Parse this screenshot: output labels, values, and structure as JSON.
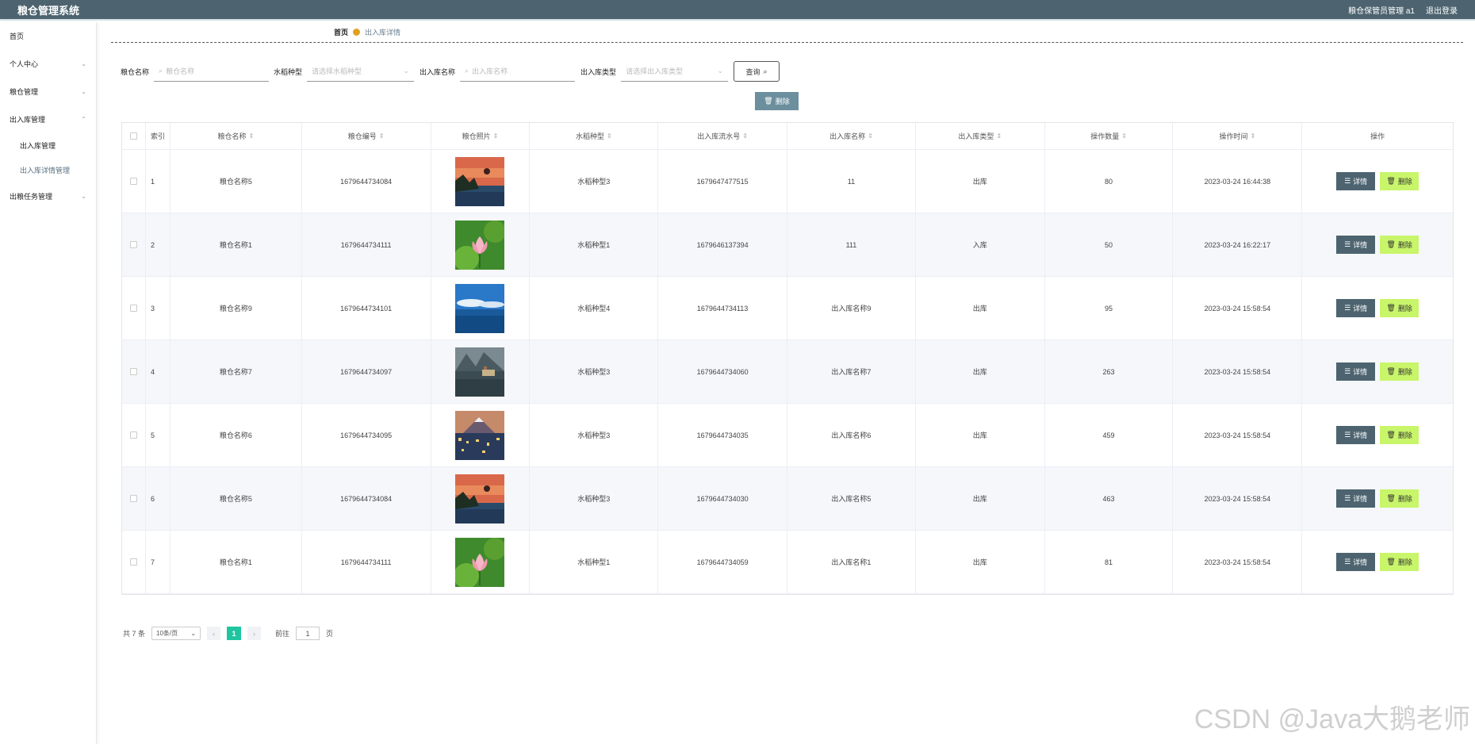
{
  "header": {
    "title": "粮仓管理系统",
    "user": "粮仓保管员管理 a1",
    "logout": "退出登录"
  },
  "sidebar": {
    "items": [
      {
        "label": "首页"
      },
      {
        "label": "个人中心"
      },
      {
        "label": "粮仓管理"
      },
      {
        "label": "出入库管理"
      }
    ],
    "sub_items": [
      {
        "label": "出入库管理"
      },
      {
        "label": "出入库详情管理"
      }
    ],
    "last_item": {
      "label": "出粮任务管理"
    }
  },
  "breadcrumb": {
    "home": "首页",
    "current": "出入库详情"
  },
  "search": {
    "name_label": "粮仓名称",
    "name_placeholder": "粮仓名称",
    "type_label": "水稻种型",
    "type_placeholder": "请选择水稻种型",
    "ioname_label": "出入库名称",
    "ioname_placeholder": "出入库名称",
    "iotype_label": "出入库类型",
    "iotype_placeholder": "请选择出入库类型",
    "query_label": "查询"
  },
  "toolbar": {
    "delete_label": "删除"
  },
  "table": {
    "columns": [
      "索引",
      "粮仓名称",
      "粮仓编号",
      "粮仓照片",
      "水稻种型",
      "出入库流水号",
      "出入库名称",
      "出入库类型",
      "操作数量",
      "操作时间",
      "操作"
    ],
    "rows": [
      {
        "idx": "1",
        "name": "粮仓名称5",
        "num": "1679644734084",
        "img": "sunset-lake",
        "type": "水稻种型3",
        "flow": "1679647477515",
        "ioname": "11",
        "iotype": "出库",
        "qty": "80",
        "time": "2023-03-24 16:44:38"
      },
      {
        "idx": "2",
        "name": "粮仓名称1",
        "num": "1679644734111",
        "img": "lotus",
        "type": "水稻种型1",
        "flow": "1679646137394",
        "ioname": "111",
        "iotype": "入库",
        "qty": "50",
        "time": "2023-03-24 16:22:17"
      },
      {
        "idx": "3",
        "name": "粮仓名称9",
        "num": "1679644734101",
        "img": "ocean-sky",
        "type": "水稻种型4",
        "flow": "1679644734113",
        "ioname": "出入库名称9",
        "iotype": "出库",
        "qty": "95",
        "time": "2023-03-24 15:58:54"
      },
      {
        "idx": "4",
        "name": "粮仓名称7",
        "num": "1679644734097",
        "img": "mountain-village",
        "type": "水稻种型3",
        "flow": "1679644734060",
        "ioname": "出入库名称7",
        "iotype": "出库",
        "qty": "263",
        "time": "2023-03-24 15:58:54"
      },
      {
        "idx": "5",
        "name": "粮仓名称6",
        "num": "1679644734095",
        "img": "city-mountain",
        "type": "水稻种型3",
        "flow": "1679644734035",
        "ioname": "出入库名称6",
        "iotype": "出库",
        "qty": "459",
        "time": "2023-03-24 15:58:54"
      },
      {
        "idx": "6",
        "name": "粮仓名称5",
        "num": "1679644734084",
        "img": "sunset-lake",
        "type": "水稻种型3",
        "flow": "1679644734030",
        "ioname": "出入库名称5",
        "iotype": "出库",
        "qty": "463",
        "time": "2023-03-24 15:58:54"
      },
      {
        "idx": "7",
        "name": "粮仓名称1",
        "num": "1679644734111",
        "img": "lotus",
        "type": "水稻种型1",
        "flow": "1679644734059",
        "ioname": "出入库名称1",
        "iotype": "出库",
        "qty": "81",
        "time": "2023-03-24 15:58:54"
      }
    ],
    "detail_label": "详情",
    "delete_label": "删除"
  },
  "pager": {
    "total": "共 7 条",
    "size": "10条/页",
    "current": "1",
    "goto_label": "前往",
    "goto_value": "1",
    "page_suffix": "页"
  },
  "watermark": "CSDN @Java大鹅老师",
  "colors": {
    "header": "#4d6470",
    "accent": "#1ec6a0",
    "delete": "#c8f56a"
  }
}
